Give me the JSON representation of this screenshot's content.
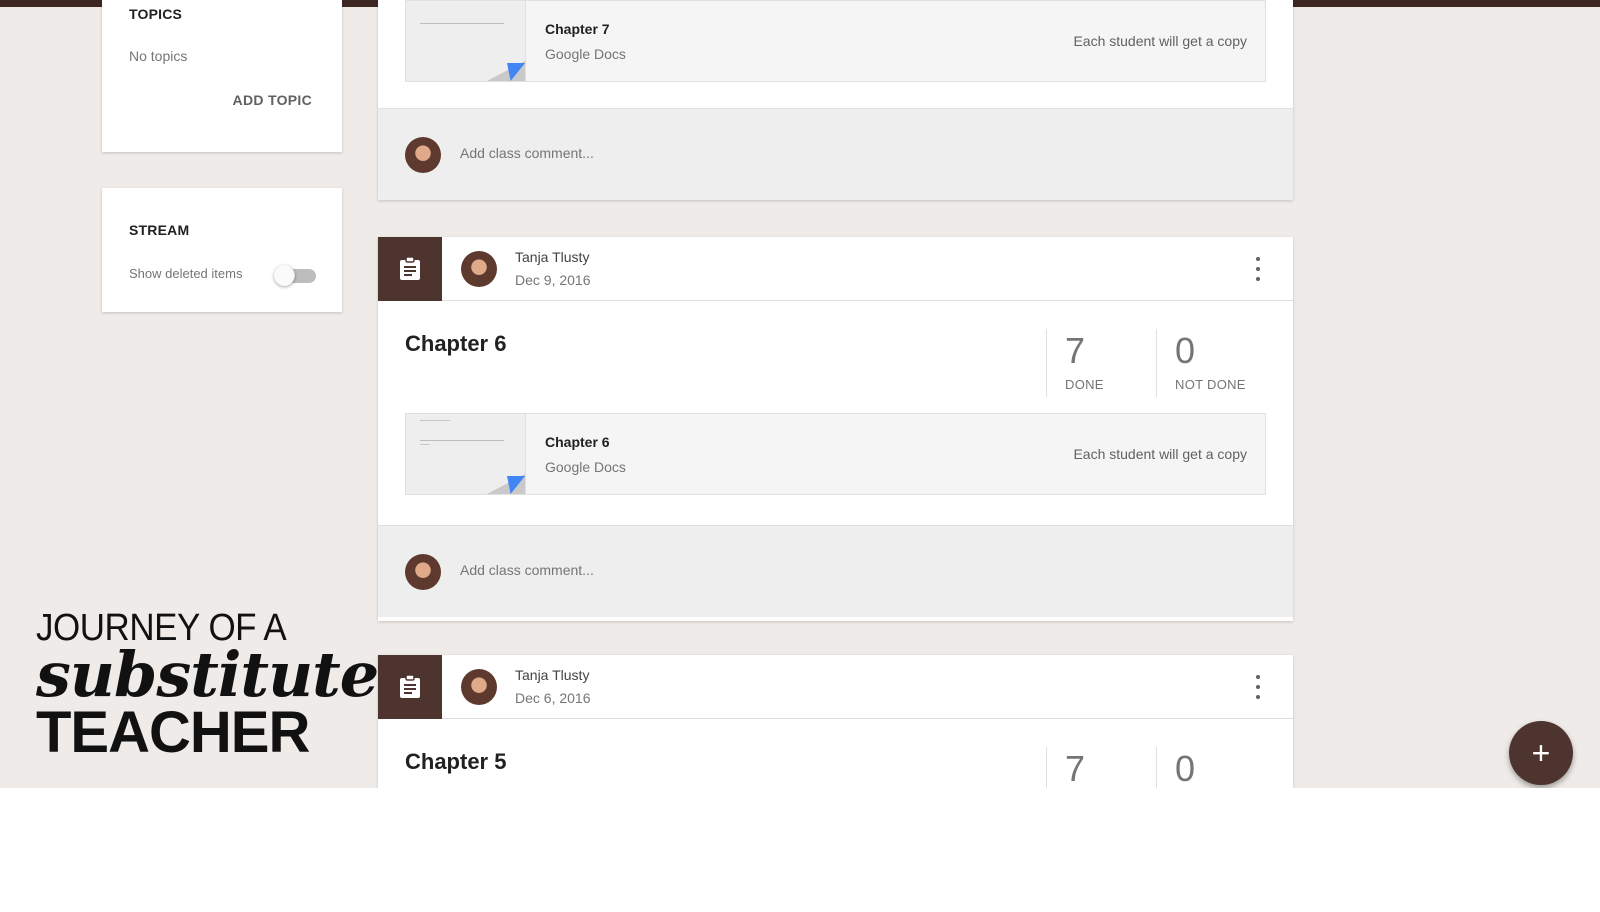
{
  "sidebar": {
    "topics": {
      "heading": "TOPICS",
      "empty_text": "No topics",
      "add_label": "ADD TOPIC"
    },
    "stream": {
      "heading": "STREAM",
      "toggle_label": "Show deleted items",
      "toggle_on": false
    }
  },
  "posts": [
    {
      "attachment": {
        "title": "Chapter 7",
        "subtitle": "Google Docs",
        "note": "Each student will get a copy"
      },
      "comment_placeholder": "Add class comment..."
    },
    {
      "author": "Tanja Tlusty",
      "date": "Dec 9, 2016",
      "title": "Chapter 6",
      "done_count": "7",
      "done_label": "DONE",
      "not_done_count": "0",
      "not_done_label": "NOT DONE",
      "attachment": {
        "title": "Chapter 6",
        "subtitle": "Google Docs",
        "note": "Each student will get a copy"
      },
      "comment_placeholder": "Add class comment..."
    },
    {
      "author": "Tanja Tlusty",
      "date": "Dec 6, 2016",
      "title": "Chapter 5",
      "done_count": "7",
      "not_done_count": "0"
    }
  ],
  "fab": {
    "label": "+"
  },
  "logo": {
    "line1": "JOURNEY OF A",
    "line2": "substitute",
    "line3": "TEACHER"
  },
  "colors": {
    "primary": "#4e342e",
    "topbar": "#3e2723",
    "background": "#efebe9",
    "docs_blue": "#4285f4"
  },
  "icons": {
    "assignment": "clipboard-icon",
    "menu": "more-vert-icon",
    "fab": "plus-icon"
  }
}
